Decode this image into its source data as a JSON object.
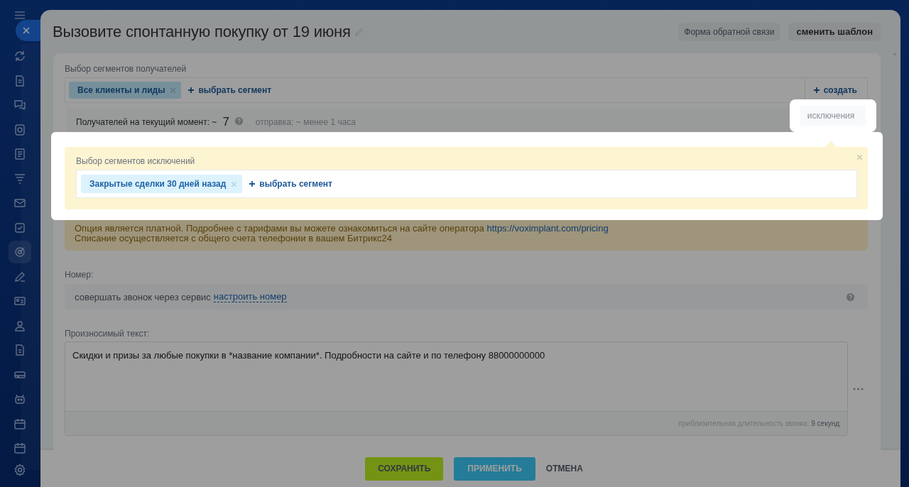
{
  "header": {
    "title": "Вызовите спонтанную покупку от 19 июня",
    "buttons": [
      {
        "label": "Форма обратной связи",
        "kind": "light"
      },
      {
        "label": "сменить шаблон",
        "kind": "bold"
      }
    ]
  },
  "recipients": {
    "label": "Выбор сегментов получателей",
    "segments": [
      {
        "label": "Все клиенты и лиды"
      }
    ],
    "add_link": "выбрать сегмент",
    "create_link": "создать",
    "count_label": "Получателей на текущий момент: ~",
    "count": "7",
    "send_time": "отправка: ~ менее 1 часа"
  },
  "hint": {
    "text": "исключения"
  },
  "exclusions": {
    "label": "Выбор сегментов исключений",
    "segments": [
      {
        "label": "Закрытые сделки 30 дней назад"
      }
    ],
    "add_link": "выбрать сегмент"
  },
  "notice": {
    "text": "Опция является платной. Подробнее с тарифами вы можете ознакомиться на сайте оператора",
    "link": "https://voximplant.com/pricing",
    "text_2": "Списание осуществляется с общего счета телефонии в вашем Битрикс24"
  },
  "number": {
    "label": "Номер:",
    "text": "совершать звонок через сервис",
    "link": "настроить номер"
  },
  "speech": {
    "label": "Произносимый текст:",
    "value": "Скидки и призы за любые покупки в *название компании*. Подробности на сайте и по телефону 88000000000",
    "duration_label": "приблизительная длительность звонка:",
    "duration": "9 секунд"
  },
  "footer": {
    "buttons": [
      {
        "label": "СОХРАНИТЬ",
        "kind": "save"
      },
      {
        "label": "ПРИМЕНИТЬ",
        "kind": "apply"
      },
      {
        "label": "ОТМЕНА",
        "kind": "cancel"
      }
    ]
  }
}
